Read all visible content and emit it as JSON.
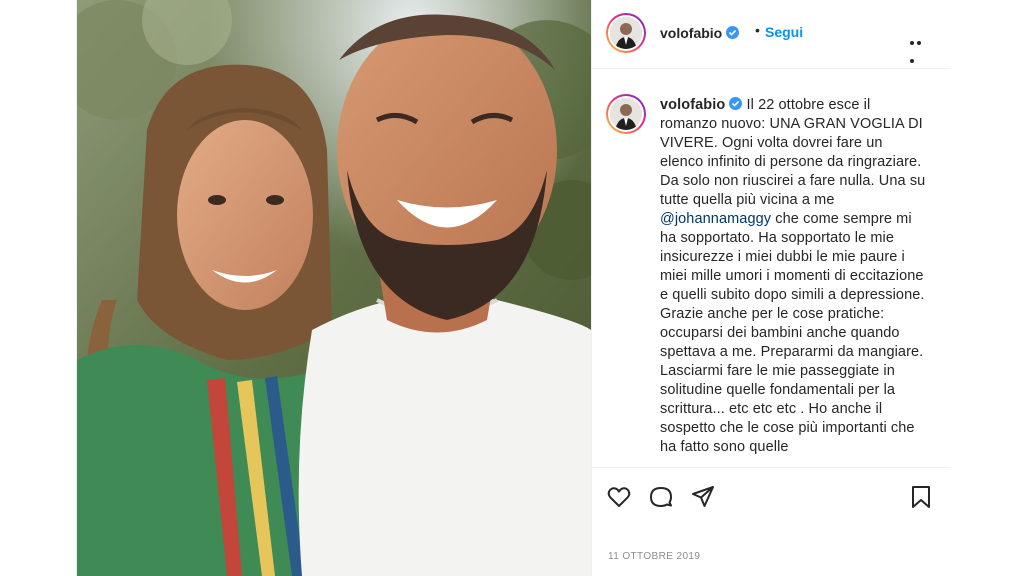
{
  "post": {
    "username": "volofabio",
    "follow_label": "Segui",
    "separator": "•",
    "caption": {
      "username": "volofabio",
      "text_before_mention": "Il 22 ottobre esce il romanzo nuovo: UNA GRAN VOGLIA DI VIVERE. Ogni volta dovrei fare un elenco infinito di persone da ringraziare. Da solo non riuscirei a fare nulla. Una su tutte quella più vicina a me",
      "mention": "@johannamaggy",
      "text_after_mention": "che come sempre mi ha sopportato. Ha sopportato le mie insicurezze i miei dubbi le mie paure i miei mille umori i momenti di eccitazione e quelli subito dopo simili a depressione. Grazie anche per le cose pratiche: occuparsi dei bambini anche quando spettava a me. Prepararmi da mangiare. Lasciarmi fare le mie passeggiate in solitudine quelle fondamentali per la scrittura... etc etc etc . Ho anche il sospetto che le cose più importanti che ha fatto sono quelle"
    },
    "date": "11 ottobre 2019",
    "icons": {
      "verified": "verified-badge-icon",
      "more": "more-options-icon",
      "like": "heart-icon",
      "comment": "comment-icon",
      "share": "send-icon",
      "save": "bookmark-icon"
    },
    "colors": {
      "link": "#0095f6",
      "verified": "#3897f0",
      "mention": "#00376b",
      "muted": "#8e8e8e"
    }
  }
}
